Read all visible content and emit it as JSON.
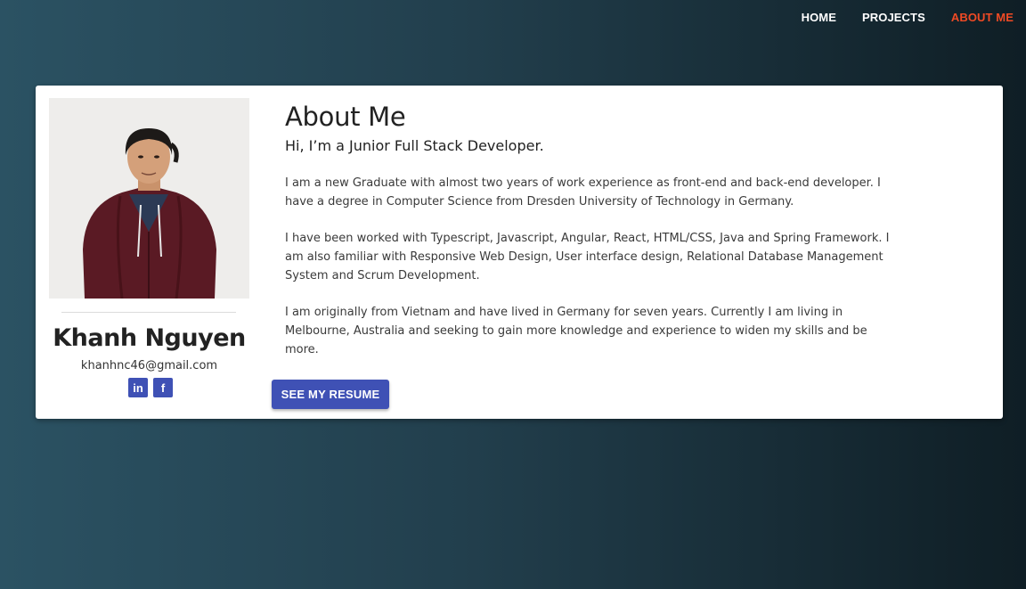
{
  "nav": {
    "items": [
      {
        "label": "HOME",
        "active": false
      },
      {
        "label": "PROJECTS",
        "active": false
      },
      {
        "label": "ABOUT ME",
        "active": true
      }
    ],
    "active_color": "#ef4a24"
  },
  "profile": {
    "name": "Khanh Nguyen",
    "email": "khanhnc46@gmail.com",
    "socials": [
      {
        "icon": "linkedin-icon",
        "glyph": "in"
      },
      {
        "icon": "facebook-icon",
        "glyph": "f"
      }
    ]
  },
  "about": {
    "heading": "About Me",
    "subheading": "Hi, I’m a Junior Full Stack Developer.",
    "paragraphs": [
      "I am a new Graduate with almost two years of work experience as front-end and back-end developer. I have a degree in Computer Science from Dresden University of Technology in Germany.",
      "I have been worked with Typescript, Javascript, Angular, React, HTML/CSS, Java and Spring Framework. I am also familiar with Responsive Web Design, User interface design, Relational Database Management System and Scrum Development.",
      "I am originally from Vietnam and have lived in Germany for seven years. Currently I am living in Melbourne, Australia and seeking to gain more knowledge and experience to widen my skills and be more."
    ],
    "button_label": "SEE MY RESUME"
  },
  "colors": {
    "accent": "#3f51b5",
    "nav_active": "#ef4a24"
  }
}
